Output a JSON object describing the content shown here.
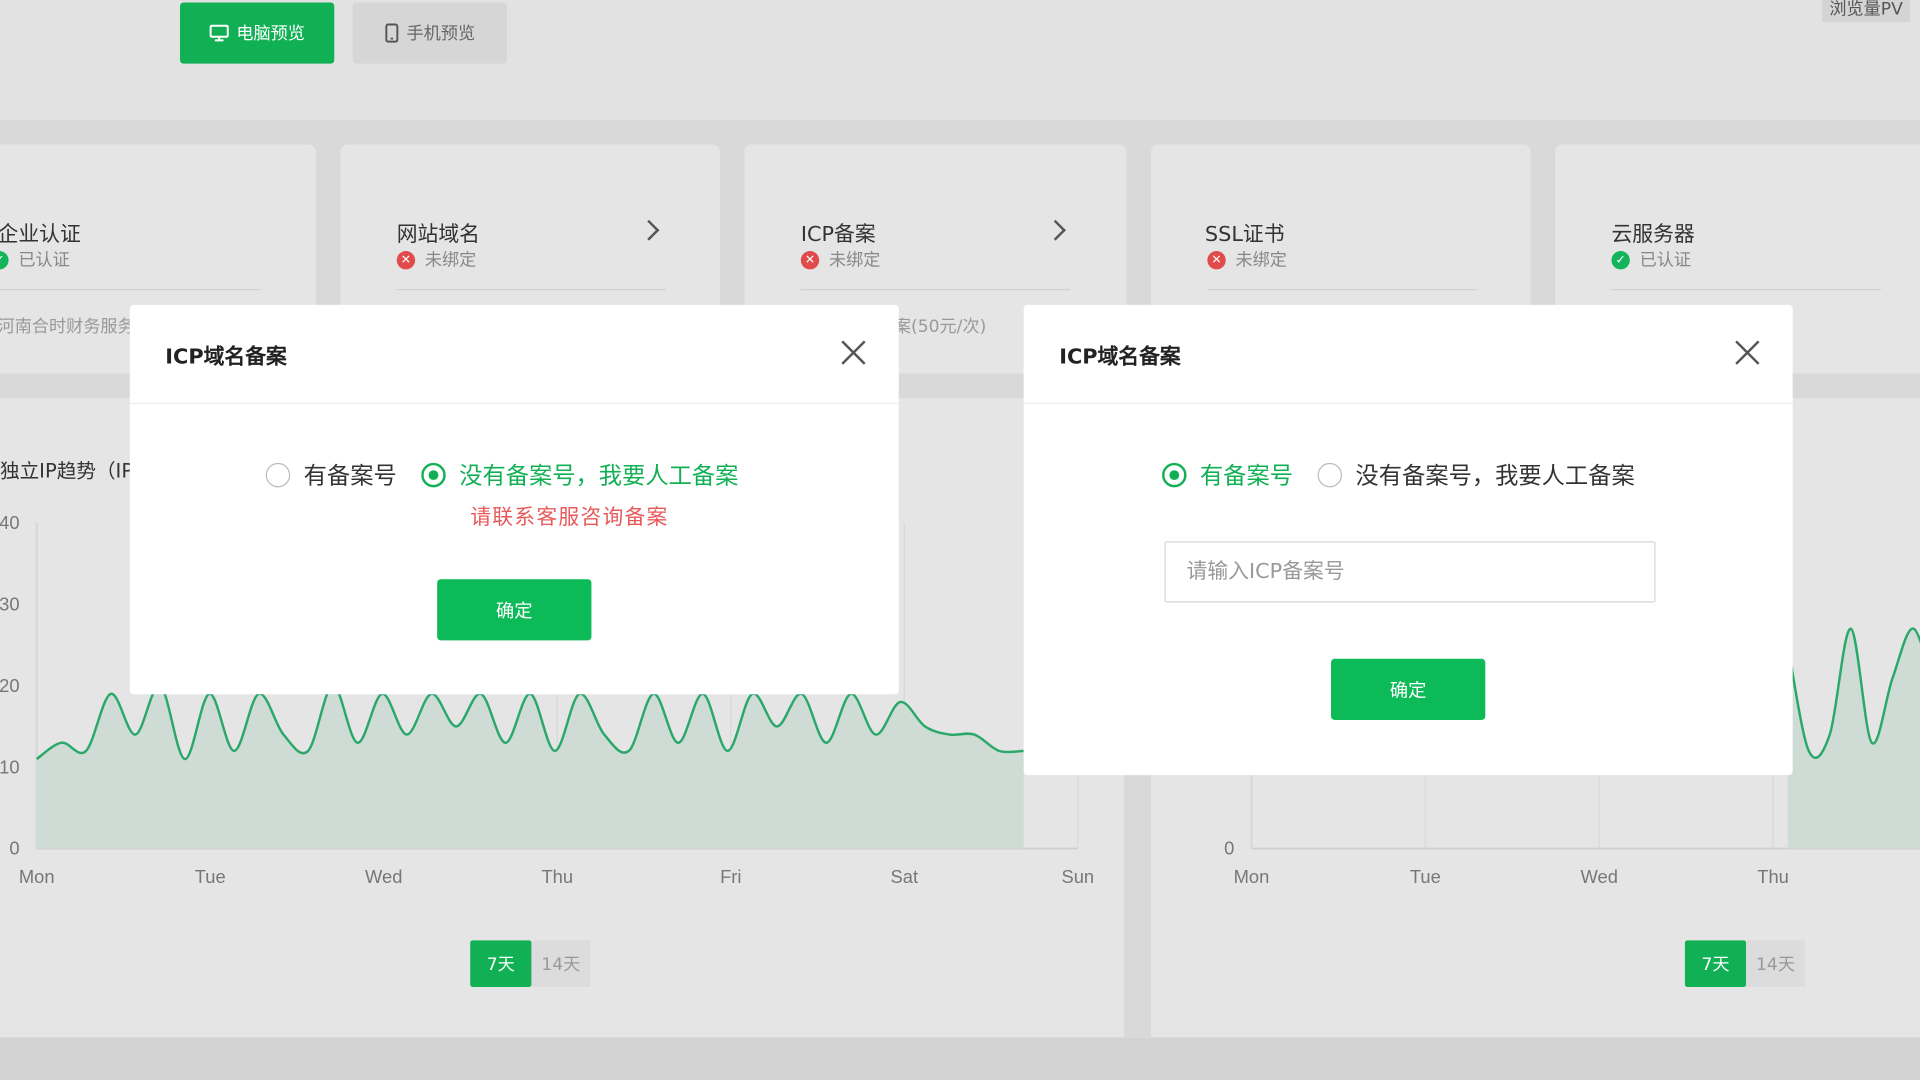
{
  "topbar": {
    "pc_preview": "电脑预览",
    "mobile_preview": "手机预览",
    "pv_label": "浏览量PV"
  },
  "cards": [
    {
      "title": "企业认证",
      "status": "已认证",
      "status_type": "ok",
      "footer": "河南合时财务服务"
    },
    {
      "title": "网站域名",
      "status": "未绑定",
      "status_type": "err"
    },
    {
      "title": "ICP备案",
      "status": "未绑定",
      "status_type": "err",
      "footer": "案(50元/次)"
    },
    {
      "title": "SSL证书",
      "status": "未绑定",
      "status_type": "err"
    },
    {
      "title": "云服务器",
      "status": "已认证",
      "status_type": "ok"
    }
  ],
  "left_panel": {
    "title": "独立IP趋势（IP",
    "range_7": "7天",
    "range_14": "14天"
  },
  "right_panel": {
    "range_7": "7天",
    "range_14": "14天"
  },
  "chart_data": [
    {
      "type": "area",
      "x": [
        "Mon",
        "Tue",
        "Wed",
        "Thu",
        "Fri",
        "Sat",
        "Sun"
      ],
      "yticks": [
        0,
        10,
        20,
        30,
        40
      ],
      "ylim": [
        0,
        40
      ],
      "color": "#2aa86a",
      "series": [
        {
          "values": [
            11,
            13,
            12,
            19,
            14,
            20,
            11,
            19,
            12,
            19,
            14,
            12,
            20,
            13,
            19,
            14,
            19,
            15,
            19,
            13,
            19,
            12,
            19,
            14,
            12,
            19,
            13,
            19,
            12,
            19,
            15,
            19,
            13,
            19,
            14,
            18,
            15,
            14,
            14,
            12,
            12
          ]
        }
      ]
    },
    {
      "type": "area",
      "x": [
        "Mon",
        "Tue",
        "Wed",
        "Thu"
      ],
      "yticks": [
        0
      ],
      "color": "#2aa86a",
      "series": [
        {
          "values": [
            25,
            12,
            14,
            27,
            13,
            21,
            27,
            19
          ]
        }
      ]
    }
  ],
  "modal_left": {
    "title": "ICP域名备案",
    "option_has": "有备案号",
    "option_none": "没有备案号，我要人工备案",
    "selected": "none",
    "hint": "请联系客服咨询备案",
    "confirm": "确定"
  },
  "modal_right": {
    "title": "ICP域名备案",
    "option_has": "有备案号",
    "option_none": "没有备案号，我要人工备案",
    "selected": "has",
    "input_placeholder": "请输入ICP备案号",
    "confirm": "确定"
  }
}
